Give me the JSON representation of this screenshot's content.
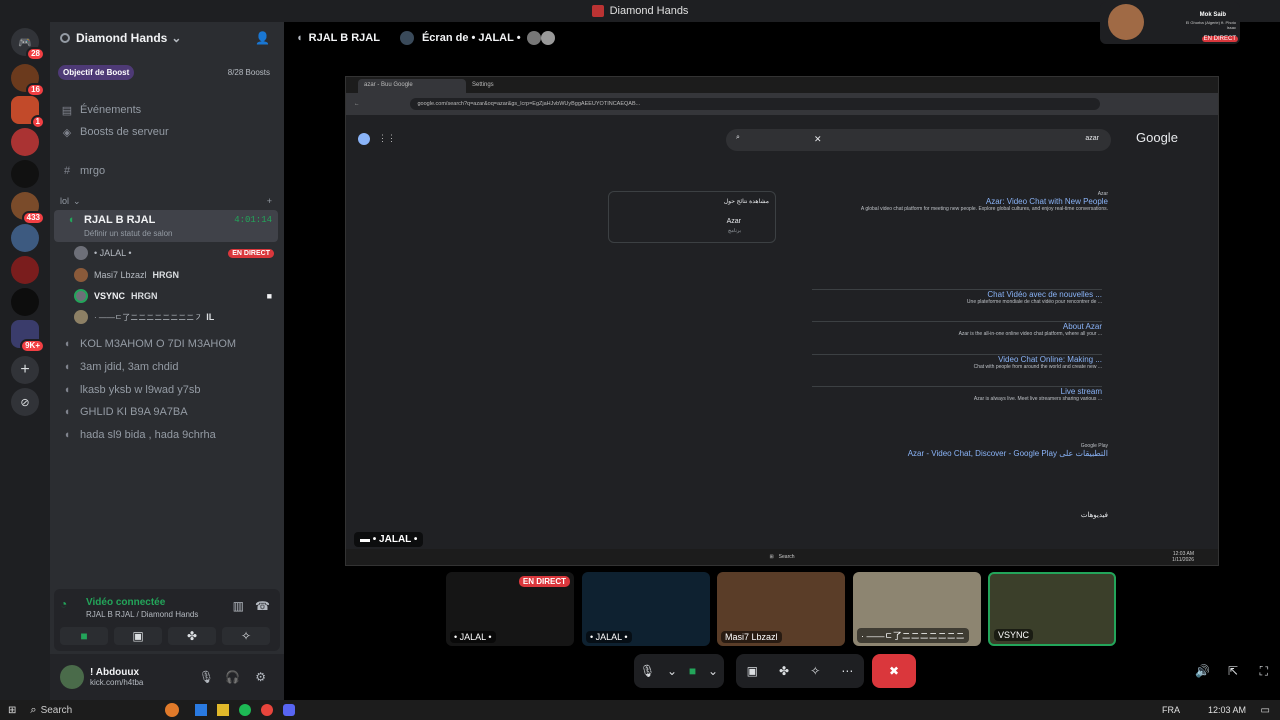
{
  "window": {
    "title": "Diamond Hands"
  },
  "server_badges": [
    "28",
    "16",
    "1",
    "433",
    "9K+"
  ],
  "guild": {
    "name": "Diamond Hands",
    "boost_label": "Objectif de Boost",
    "boost_count": "8/28 Boosts"
  },
  "nav": {
    "events": "Événements",
    "boosts": "Boosts de serveur"
  },
  "channels": {
    "text": "mrgo",
    "category": "lol",
    "active_voice": {
      "name": "RJAL B RJAL",
      "timer": "4:01:14",
      "status": "Définir un statut de salon"
    },
    "voice_users": [
      {
        "name": "• JALAL •",
        "live": "EN DIRECT"
      },
      {
        "name": "Masi7 Lbzazl",
        "tag": "HRGN"
      },
      {
        "name": "VSYNC",
        "tag": "HRGN"
      },
      {
        "name": "· ——ㄷ了ニニニニニニニニ㇇",
        "tag": "IL"
      }
    ],
    "others": [
      "KOL M3AHOM O 7DI M3AHOM",
      "3am jdid, 3am chdid",
      "lkasb yksb w l9wad y7sb",
      "GHLID KI B9A 9A7BA",
      "hada sl9 bida , hada 9chrha"
    ]
  },
  "voice_status": {
    "title": "Vidéo connectée",
    "sub": "RJAL B RJAL / Diamond Hands"
  },
  "user": {
    "name": "! Abdouux",
    "status": "kick.com/h4tba"
  },
  "main_header": {
    "channel": "RJAL B RJAL",
    "screen": "Écran de • JALAL •"
  },
  "stream": {
    "label": "• JALAL •",
    "tabs": [
      "azar - Buu Google",
      "Settings"
    ],
    "url": "google.com/search?q=azar&oq=azar&gs_lcrp=EgZjaHJvbWUyBggAEEUYOTINCAEQAB...",
    "search_query": "azar",
    "logo": "Google",
    "kp_title": "مشاهدة نتائج حول",
    "kp_item": "Azar",
    "kp_sub": "برنامج",
    "results": [
      {
        "site": "Azar",
        "title": "Azar: Video Chat with New People",
        "desc": "A global video chat platform for meeting new people. Explore global cultures, and enjoy real-time conversations."
      },
      {
        "site": "",
        "title": "Chat Vidéo avec de nouvelles ...",
        "desc": "Une plateforme mondiale de chat vidéo pour rencontrer de ..."
      },
      {
        "site": "",
        "title": "About Azar",
        "desc": "Azar is the all-in-one online video chat platform, where all your ..."
      },
      {
        "site": "",
        "title": "Video Chat Online: Making ...",
        "desc": "Chat with people from around the world and create new ..."
      },
      {
        "site": "",
        "title": "Live stream",
        "desc": "Azar is always live. Meet live streamers sharing various ..."
      }
    ],
    "play_site": "Google Play",
    "play_title": "Azar - Video Chat, Discover - Google Play التطبيقات على",
    "videos_label": "فيديوهات",
    "taskbar_search": "Search",
    "time": "12:03 AM",
    "date": "1/11/2026"
  },
  "tiles": [
    {
      "name": "• JALAL •",
      "live": "EN DIRECT"
    },
    {
      "name": "• JALAL •"
    },
    {
      "name": "Masi7 Lbzazl"
    },
    {
      "name": "· ——ㄷ了ニニニニニニニ"
    },
    {
      "name": "VSYNC"
    }
  ],
  "pip": {
    "name": "Mok Saib",
    "sub": "El Ghorba (Algerie) ft. Photo Issac",
    "live": "EN DIRECT"
  },
  "taskbar": {
    "search": "Search",
    "lang": "FRA",
    "time": "12:03 AM"
  },
  "colors": {
    "accent": "#23a55a",
    "live": "#da373c",
    "bg": "#000000",
    "sidebar": "#2b2d31"
  }
}
